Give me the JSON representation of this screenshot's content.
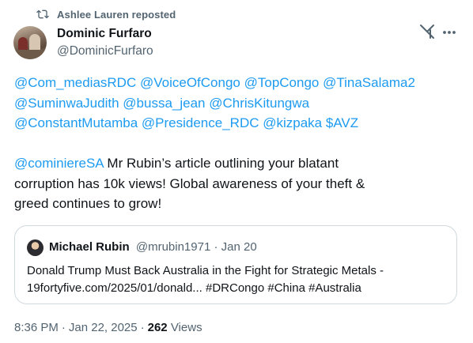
{
  "repost": {
    "label": "Ashlee Lauren reposted",
    "icon": "repost-icon"
  },
  "author": {
    "display_name": "Dominic Furfaro",
    "handle": "@DominicFurfaro",
    "avatar_icon": "avatar"
  },
  "header_actions": {
    "grok_icon": "grok-icon",
    "more_icon": "more-icon"
  },
  "tweet": {
    "line1": [
      "@Com_mediasRDC",
      "@VoiceOfCongo",
      "@TopCongo",
      "@TinaSalama2"
    ],
    "line2": [
      "@SuminwaJudith",
      "@bussa_jean",
      "@ChrisKitungwa"
    ],
    "line3": [
      "@ConstantMutamba",
      "@Presidence_RDC",
      "@kizpaka",
      "$AVZ"
    ],
    "body_mention": "@cominiereSA",
    "body_line1_rest": " Mr Rubin’s article outlining your blatant",
    "body_line2": "corruption has 10k views! Global awareness of your theft &",
    "body_line3": "greed continues to grow!"
  },
  "quote": {
    "name": "Michael Rubin",
    "handle": "@mrubin1971",
    "date": "Jan 20",
    "text_line1": "Donald Trump Must Back Australia in the Fight for Strategic Metals -",
    "text_line2_link": "19fortyfive.com/2025/01/donald...",
    "hashtags": [
      "#DRCongo",
      "#China",
      "#Australia"
    ]
  },
  "meta": {
    "time": "8:36 PM",
    "date": "Jan 22, 2025",
    "views_count": "262",
    "views_label": "Views"
  },
  "colors": {
    "link": "#1d9bf0",
    "muted": "#536471",
    "text": "#0f1419",
    "border": "#cfd9de"
  }
}
